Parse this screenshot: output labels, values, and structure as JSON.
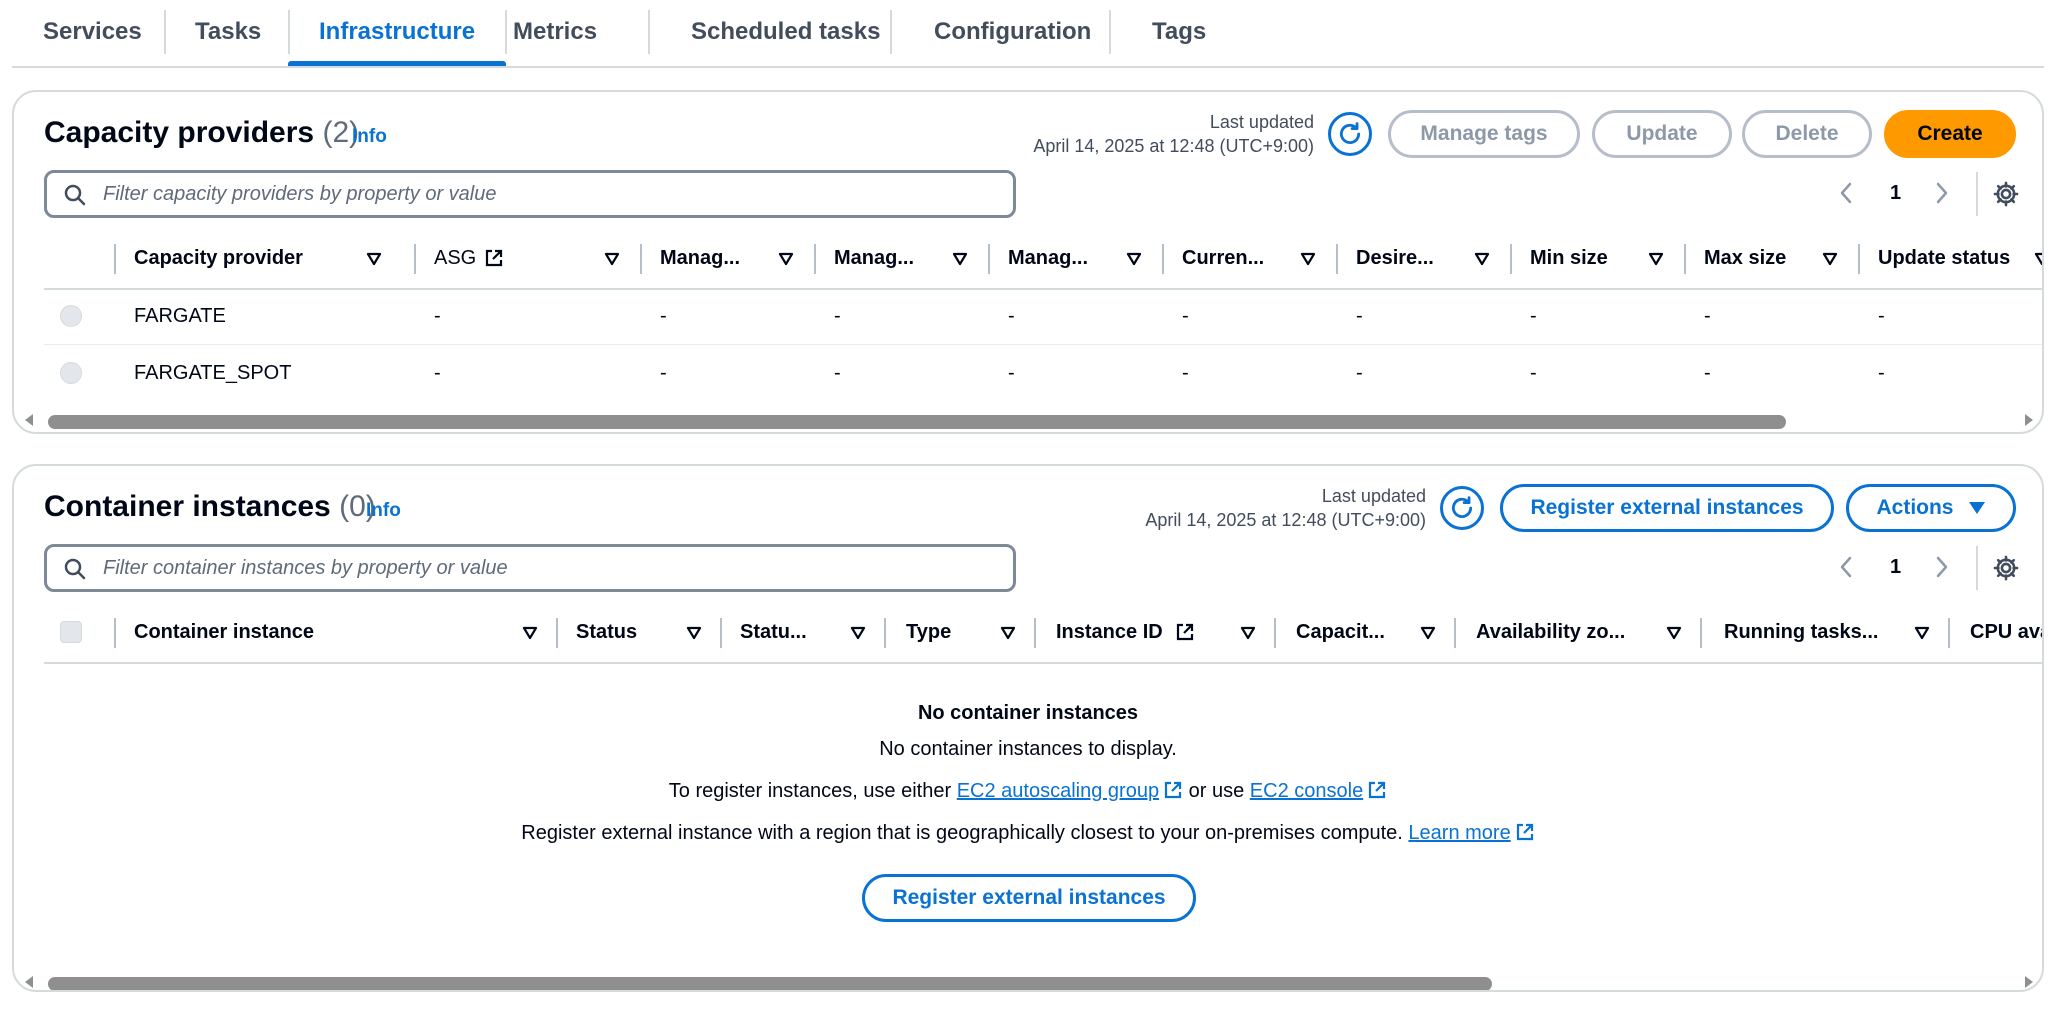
{
  "tabs": [
    {
      "label": "Services"
    },
    {
      "label": "Tasks"
    },
    {
      "label": "Infrastructure"
    },
    {
      "label": "Metrics"
    },
    {
      "label": "Scheduled tasks"
    },
    {
      "label": "Configuration"
    },
    {
      "label": "Tags"
    }
  ],
  "active_tab": "Infrastructure",
  "capacity": {
    "title": "Capacity providers",
    "count": "(2)",
    "info": "Info",
    "last_updated_label": "Last updated",
    "last_updated_value": "April 14, 2025 at 12:48 (UTC+9:00)",
    "buttons": {
      "manage_tags": "Manage tags",
      "update": "Update",
      "delete": "Delete",
      "create": "Create"
    },
    "filter_placeholder": "Filter capacity providers by property or value",
    "page": "1",
    "columns": [
      "Capacity provider",
      "ASG",
      "Manag...",
      "Manag...",
      "Manag...",
      "Curren...",
      "Desire...",
      "Min size",
      "Max size",
      "Update status"
    ],
    "rows": [
      {
        "name": "FARGATE",
        "cells": [
          "-",
          "-",
          "-",
          "-",
          "-",
          "-",
          "-",
          "-",
          "-"
        ]
      },
      {
        "name": "FARGATE_SPOT",
        "cells": [
          "-",
          "-",
          "-",
          "-",
          "-",
          "-",
          "-",
          "-",
          "-"
        ]
      }
    ]
  },
  "container": {
    "title": "Container instances",
    "count": "(0)",
    "info": "Info",
    "last_updated_label": "Last updated",
    "last_updated_value": "April 14, 2025 at 12:48 (UTC+9:00)",
    "buttons": {
      "register": "Register external instances",
      "actions": "Actions"
    },
    "filter_placeholder": "Filter container instances by property or value",
    "page": "1",
    "columns": [
      "Container instance",
      "Status",
      "Statu...",
      "Type",
      "Instance ID",
      "Capacit...",
      "Availability zo...",
      "Running tasks...",
      "CPU ava"
    ],
    "empty": {
      "heading": "No container instances",
      "subtitle": "No container instances to display.",
      "line1_prefix": "To register instances, use either",
      "line1_link1": "EC2 autoscaling group",
      "line1_mid": "or use",
      "line1_link2": "EC2 console",
      "line2_text": "Register external instance with a region that is geographically closest to your on-premises compute.",
      "line2_link": "Learn more",
      "button": "Register external instances"
    }
  },
  "colors": {
    "accent": "#0972d3",
    "primary_button": "#ff9900",
    "border": "#d5dbdb",
    "muted": "#5f6b7a"
  }
}
